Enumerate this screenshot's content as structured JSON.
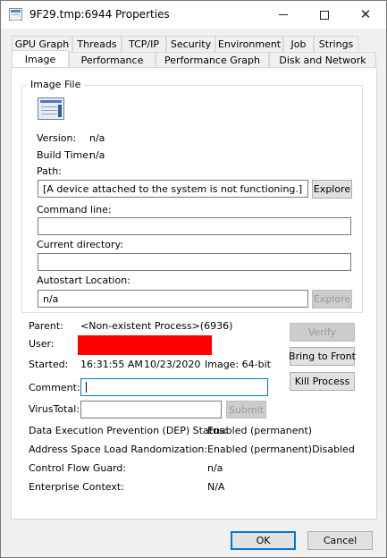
{
  "window": {
    "title": "9F29.tmp:6944 Properties",
    "icon": "properties-window-icon",
    "controls": [
      "minimize-icon",
      "maximize-icon",
      "close-icon"
    ]
  },
  "tabs_top": [
    "GPU Graph",
    "Threads",
    "TCP/IP",
    "Security",
    "Environment",
    "Job",
    "Strings"
  ],
  "tabs_bottom": [
    "Image",
    "Performance",
    "Performance Graph",
    "Disk and Network"
  ],
  "active_tab": "Image",
  "image_file": {
    "group_label": "Image File",
    "icon": "executable-file-icon",
    "version_label": "Version:",
    "version_value": "n/a",
    "build_time_label": "Build Time:",
    "build_time_value": "n/a",
    "path_label": "Path:",
    "path_value": "[A device attached to the system is not functioning.]",
    "explore_label": "Explore",
    "command_line_label": "Command line:",
    "command_line_value": "",
    "current_directory_label": "Current directory:",
    "current_directory_value": "",
    "autostart_label": "Autostart Location:",
    "autostart_value": "n/a",
    "autostart_explore_label": "Explore"
  },
  "process": {
    "parent_label": "Parent:",
    "parent_value": "<Non-existent Process>(6936)",
    "user_label": "User:",
    "started_label": "Started:",
    "started_time": "16:31:55 AM",
    "started_date": "10/23/2020",
    "image_bits": "Image: 64-bit",
    "comment_label": "Comment:",
    "comment_value": "",
    "virustotal_label": "VirusTotal:",
    "virustotal_value": "",
    "submit_label": "Submit",
    "verify_label": "Verify",
    "bring_to_front_label": "Bring to Front",
    "kill_process_label": "Kill Process"
  },
  "security_info": {
    "dep_label": "Data Execution Prevention (DEP) Status:",
    "dep_value": "Enabled (permanent)",
    "aslr_label": "Address Space Load Randomization:",
    "aslr_value": "Enabled (permanent)Disabled",
    "cfg_label": "Control Flow Guard:",
    "cfg_value": "n/a",
    "enterprise_label": "Enterprise Context:",
    "enterprise_value": "N/A"
  },
  "footer": {
    "ok_label": "OK",
    "cancel_label": "Cancel"
  },
  "colors": {
    "redaction": "#ff0000",
    "focus_accent": "#0078d7"
  }
}
